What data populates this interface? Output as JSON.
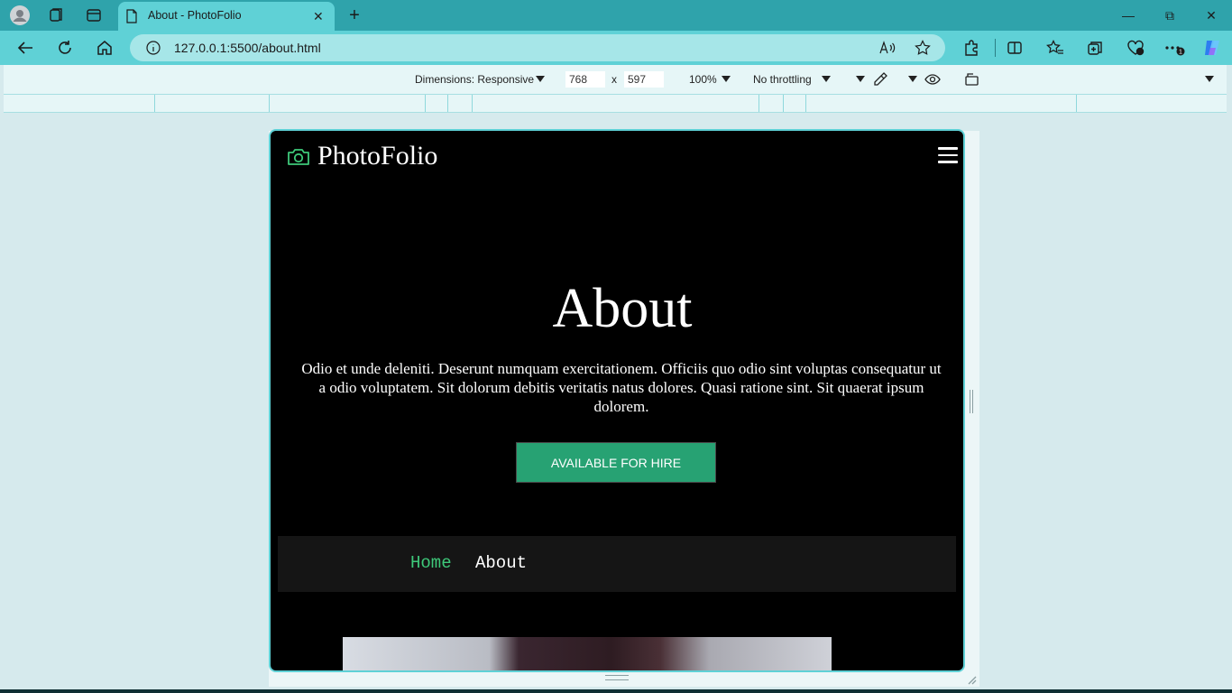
{
  "browser": {
    "tab_title": "About - PhotoFolio",
    "tab_close": "✕",
    "new_tab": "+",
    "url": "127.0.0.1:5500/about.html",
    "window_controls": {
      "minimize": "—",
      "restore": "⧉",
      "close": "✕"
    }
  },
  "devtools": {
    "dimensions_label": "Dimensions: Responsive",
    "width": "768",
    "times": "x",
    "height": "597",
    "zoom": "100%",
    "throttling": "No throttling"
  },
  "site": {
    "brand": "PhotoFolio",
    "hero_title": "About",
    "hero_text": "Odio et unde deleniti. Deserunt numquam exercitationem. Officiis quo odio sint voluptas consequatur ut a odio voluptatem. Sit dolorum debitis veritatis natus dolores. Quasi ratione sint. Sit quaerat ipsum dolorem.",
    "hire_button": "AVAILABLE FOR HIRE",
    "breadcrumb": {
      "home": "Home",
      "current": "About"
    }
  },
  "colors": {
    "chrome": "#2fa3ab",
    "toolbar": "#5fd1d6",
    "accent_green": "#27a273",
    "breadcrumb_home": "#3ec97a"
  }
}
